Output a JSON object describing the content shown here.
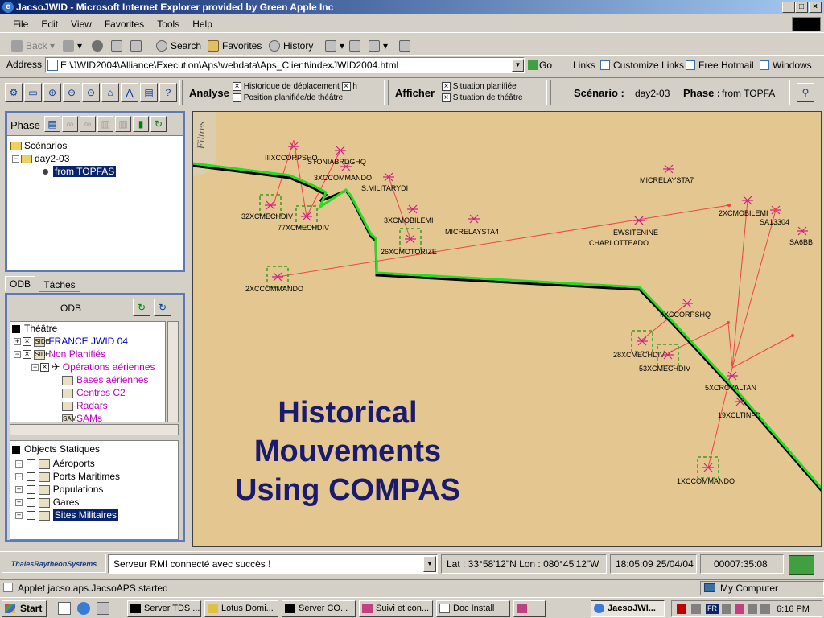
{
  "window": {
    "title": "JacsoJWID - Microsoft Internet Explorer provided by Green Apple Inc"
  },
  "menu": [
    "File",
    "Edit",
    "View",
    "Favorites",
    "Tools",
    "Help"
  ],
  "toolbar": {
    "back": "Back",
    "search": "Search",
    "favorites": "Favorites",
    "history": "History"
  },
  "address": {
    "label": "Address",
    "value": "E:\\JWID2004\\Alliance\\Execution\\Aps\\webdata\\Aps_Client\\indexJWID2004.html",
    "go": "Go",
    "links_label": "Links",
    "links": [
      "Customize Links",
      "Free Hotmail",
      "Windows"
    ]
  },
  "app_toolbar": {
    "analyse": {
      "title": "Analyse",
      "opt1": "Historique de déplacement",
      "opt1_suffix": "h",
      "opt2": "Position planifiée/de théâtre"
    },
    "afficher": {
      "title": "Afficher",
      "opt1": "Situation planifiée",
      "opt2": "Situation de théâtre"
    },
    "scenario_label": "Scénario :",
    "scenario_value": "day2-03",
    "phase_label": "Phase :",
    "phase_value": "from TOPFA"
  },
  "phase_panel": {
    "title": "Phase",
    "tree": {
      "root": "Scénarios",
      "child": "day2-03",
      "leaf": "from TOPFAS"
    }
  },
  "tabs": [
    "ODB",
    "Tâches"
  ],
  "odb": {
    "title": "ODB",
    "tree": [
      {
        "label": "Théâtre"
      },
      {
        "label": "FRANCE  JWID  04"
      },
      {
        "label": "Non Planifiés"
      },
      {
        "label": "Opérations aériennes"
      },
      {
        "label": "Bases aériennes"
      },
      {
        "label": "Centres C2"
      },
      {
        "label": "Radars"
      },
      {
        "label": "SAMs"
      }
    ]
  },
  "static_objects": {
    "title": "Objects Statiques",
    "items": [
      "Aéroports",
      "Ports Maritimes",
      "Populations",
      "Gares",
      "Sites Militaires"
    ]
  },
  "map": {
    "filters_label": "Filtres",
    "overlay_lines": [
      "Historical",
      "Mouvements",
      "Using COMPAS"
    ],
    "units": [
      {
        "label": "IIIXCCORPSHQ"
      },
      {
        "label": "STONIABRDGHQ"
      },
      {
        "label": "3XCCOMMANDO"
      },
      {
        "label": "S.MILITARYDI"
      },
      {
        "label": "32XCMECHDIV"
      },
      {
        "label": "77XCMECHDIV"
      },
      {
        "label": "3XCMOBILEMI"
      },
      {
        "label": "26XCMOTORIZE"
      },
      {
        "label": "MICRELAYSTA4"
      },
      {
        "label": "2XCCOMMANDO"
      },
      {
        "label": "MICRELAYSTA7"
      },
      {
        "label": "EWSITENINE"
      },
      {
        "label": "CHARLOTTEADO"
      },
      {
        "label": "2XCMOBILEMI"
      },
      {
        "label": "SA13304"
      },
      {
        "label": "SA6BB"
      },
      {
        "label": "IIXCCORPSHQ"
      },
      {
        "label": "28XCMECHDIV"
      },
      {
        "label": "53XCMECHDIV"
      },
      {
        "label": "5XCROYALTAN"
      },
      {
        "label": "19XCLTINFD"
      },
      {
        "label": "1XCCOMMANDO"
      }
    ]
  },
  "status": {
    "rmi": "Serveur RMI connecté avec succès !",
    "coords": "Lat : 33°58'12\"N Lon : 080°45'12\"W",
    "datetime": "18:05:09 25/04/04",
    "elapsed": "00007:35:08",
    "logo": "ThalesRaytheonSystems"
  },
  "ie_status": {
    "text": "Applet jacso.aps.JacsoAPS started",
    "zone": "My Computer"
  },
  "taskbar": {
    "start": "Start",
    "tasks": [
      "Server TDS ...",
      "Lotus Domi...",
      "Server CO...",
      "Suivi et con...",
      "Doc Install",
      "",
      "JacsoJWI..."
    ],
    "lang": "FR",
    "clock": "6:16 PM"
  },
  "colors": {
    "map_bg": "#e4c690",
    "track": "#22dd22",
    "links": "#ee4444",
    "overlay_text": "#1a1a6e",
    "panel_border": "#5a7ab8"
  }
}
